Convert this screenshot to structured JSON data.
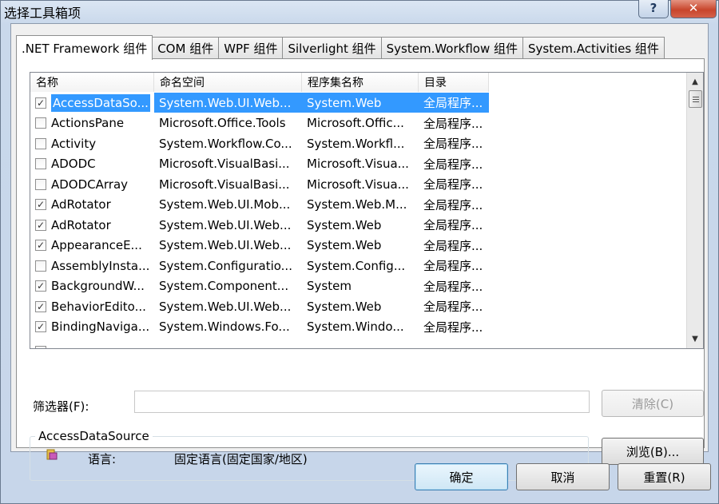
{
  "window": {
    "title": "选择工具箱项",
    "help": "?",
    "close": "✕"
  },
  "tabs": [
    ".NET Framework 组件",
    "COM 组件",
    "WPF 组件",
    "Silverlight 组件",
    "System.Workflow 组件",
    "System.Activities 组件"
  ],
  "active_tab": ".NET Framework 组件",
  "list": {
    "headers": [
      "名称",
      "命名空间",
      "程序集名称",
      "目录"
    ],
    "rows": [
      {
        "checked": true,
        "name": "AccessDataSo...",
        "namespace": "System.Web.UI.Web...",
        "assembly": "System.Web",
        "directory": "全局程序...",
        "selected": true
      },
      {
        "checked": false,
        "name": "ActionsPane",
        "namespace": "Microsoft.Office.Tools",
        "assembly": "Microsoft.Offic...",
        "directory": "全局程序..."
      },
      {
        "checked": false,
        "name": "Activity",
        "namespace": "System.Workflow.Co...",
        "assembly": "System.Workfl...",
        "directory": "全局程序..."
      },
      {
        "checked": false,
        "name": "ADODC",
        "namespace": "Microsoft.VisualBasi...",
        "assembly": "Microsoft.Visua...",
        "directory": "全局程序..."
      },
      {
        "checked": false,
        "name": "ADODCArray",
        "namespace": "Microsoft.VisualBasi...",
        "assembly": "Microsoft.Visua...",
        "directory": "全局程序..."
      },
      {
        "checked": true,
        "name": "AdRotator",
        "namespace": "System.Web.UI.Mob...",
        "assembly": "System.Web.M...",
        "directory": "全局程序..."
      },
      {
        "checked": true,
        "name": "AdRotator",
        "namespace": "System.Web.UI.Web...",
        "assembly": "System.Web",
        "directory": "全局程序..."
      },
      {
        "checked": true,
        "name": "AppearanceE...",
        "namespace": "System.Web.UI.Web...",
        "assembly": "System.Web",
        "directory": "全局程序..."
      },
      {
        "checked": false,
        "name": "AssemblyInsta...",
        "namespace": "System.Configuratio...",
        "assembly": "System.Config...",
        "directory": "全局程序..."
      },
      {
        "checked": true,
        "name": "BackgroundW...",
        "namespace": "System.Component...",
        "assembly": "System",
        "directory": "全局程序..."
      },
      {
        "checked": true,
        "name": "BehaviorEdito...",
        "namespace": "System.Web.UI.Web...",
        "assembly": "System.Web",
        "directory": "全局程序..."
      },
      {
        "checked": true,
        "name": "BindingNaviga...",
        "namespace": "System.Windows.Fo...",
        "assembly": "System.Windo...",
        "directory": "全局程序..."
      }
    ]
  },
  "filter": {
    "label": "筛选器(F):",
    "value": ""
  },
  "buttons": {
    "clear": "清除(C)",
    "browse": "浏览(B)...",
    "ok": "确定",
    "cancel": "取消",
    "reset": "重置(R)"
  },
  "details": {
    "title": "AccessDataSource",
    "language_label": "语言:",
    "language_value": "固定语言(固定国家/地区)"
  }
}
